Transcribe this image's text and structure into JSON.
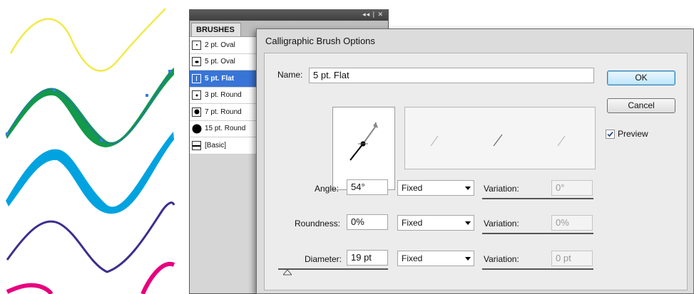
{
  "canvas": {
    "strokes": [
      {
        "name": "yellow-stroke",
        "color": "#f3e94a"
      },
      {
        "name": "green-stroke",
        "color": "#12994a"
      },
      {
        "name": "cyan-stroke",
        "color": "#00a3df"
      },
      {
        "name": "purple-stroke",
        "color": "#3d2e8c"
      },
      {
        "name": "magenta-stroke",
        "color": "#e6007e"
      }
    ]
  },
  "brushes_panel": {
    "controls": "◂◂ | ✕",
    "tab_label": "BRUSHES",
    "items": [
      {
        "label": "2 pt. Oval",
        "swatch": "dot-small"
      },
      {
        "label": "5 pt. Oval",
        "swatch": "dot-small"
      },
      {
        "label": "5 pt. Flat",
        "swatch": "flat",
        "selected": true
      },
      {
        "label": "3 pt. Round",
        "swatch": "dot-small"
      },
      {
        "label": "7 pt. Round",
        "swatch": "dot-medium"
      },
      {
        "label": "15 pt. Round",
        "swatch": "dot-large"
      },
      {
        "label": "[Basic]",
        "swatch": "basic"
      }
    ]
  },
  "dialog": {
    "title": "Calligraphic Brush Options",
    "name_label": "Name:",
    "name_value": "5 pt. Flat",
    "ok_label": "OK",
    "cancel_label": "Cancel",
    "preview_label": "Preview",
    "preview_checked": true,
    "variation_label": "Variation:",
    "rows": [
      {
        "label": "Angle:",
        "value": "54°",
        "mode": "Fixed",
        "variation": "0°"
      },
      {
        "label": "Roundness:",
        "value": "0%",
        "mode": "Fixed",
        "variation": "0%"
      },
      {
        "label": "Diameter:",
        "value": "19 pt",
        "mode": "Fixed",
        "variation": "0 pt"
      }
    ]
  },
  "colors": {
    "selection": "#3875d7",
    "panel_bg": "#d6d6d6",
    "dialog_bg": "#dcdcdc",
    "default_button": "#bee6fd"
  }
}
